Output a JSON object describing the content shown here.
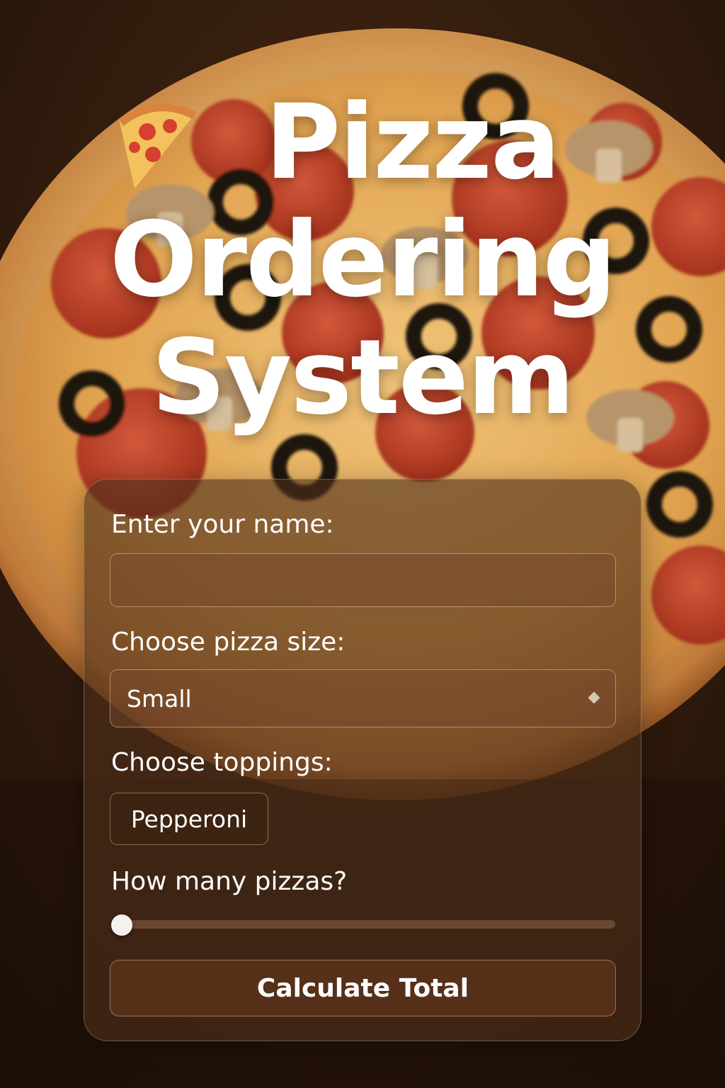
{
  "header": {
    "title_lines": [
      "Pizza",
      "Ordering",
      "System"
    ],
    "title_icon": "pizza-slice-icon"
  },
  "form": {
    "name": {
      "label": "Enter your name:",
      "value": "",
      "placeholder": ""
    },
    "size": {
      "label": "Choose pizza size:",
      "selected": "Small",
      "icon": "dropdown-diamond-icon"
    },
    "toppings": {
      "label": "Choose toppings:",
      "options": [
        "Pepperoni"
      ]
    },
    "quantity": {
      "label": "How many pizzas?",
      "value_fraction": 0
    },
    "submit": {
      "label": "Calculate Total"
    }
  },
  "colors": {
    "background": "#2a170b",
    "card": "#4e2e1a",
    "button": "#5f341c",
    "text": "#ffffff"
  }
}
